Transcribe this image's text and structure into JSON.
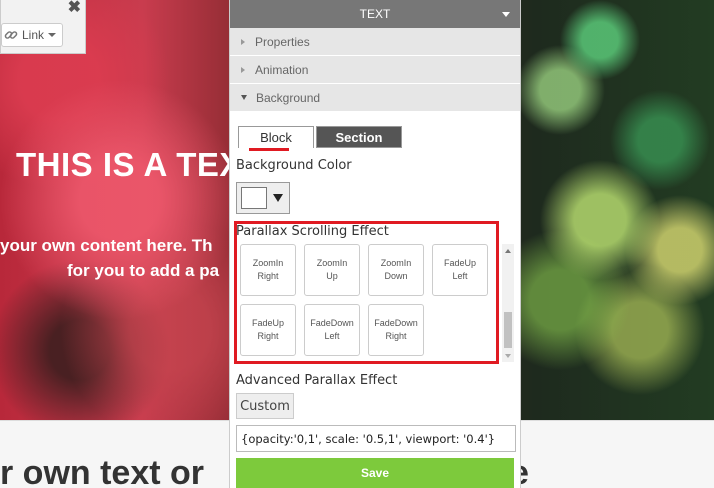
{
  "background": {
    "hero_title": "THIS IS A TEX",
    "hero_line1": "your own content here. Th",
    "hero_line2": "for you to add a pa",
    "bottom_text_left": "r own text or",
    "bottom_text_right": "e"
  },
  "mini_toolbar": {
    "close_icon": "close-icon",
    "link_label": "Link"
  },
  "panel": {
    "header_title": "TEXT",
    "accordion": [
      {
        "label": "Properties",
        "expanded": false
      },
      {
        "label": "Animation",
        "expanded": false
      },
      {
        "label": "Background",
        "expanded": true
      }
    ],
    "tabs": [
      {
        "label": "Block",
        "active": true
      },
      {
        "label": "Section",
        "active": false
      }
    ],
    "background_color_label": "Background Color",
    "background_color_value": "#ffffff",
    "parallax_label": "Parallax Scrolling Effect",
    "parallax_effects": [
      {
        "line1": "ZoomIn",
        "line2": "Right"
      },
      {
        "line1": "ZoomIn",
        "line2": "Up"
      },
      {
        "line1": "ZoomIn",
        "line2": "Down"
      },
      {
        "line1": "FadeUp",
        "line2": "Left"
      },
      {
        "line1": "FadeUp",
        "line2": "Right"
      },
      {
        "line1": "FadeDown",
        "line2": "Left"
      },
      {
        "line1": "FadeDown",
        "line2": "Right"
      }
    ],
    "advanced_label": "Advanced Parallax Effect",
    "custom_button": "Custom",
    "advanced_value": "{opacity:'0,1', scale: '0.5,1', viewport: '0.4'}",
    "save_button": "Save"
  },
  "colors": {
    "highlight_red": "#e01a22",
    "save_green": "#7dca3c",
    "header_gray": "#777777"
  }
}
